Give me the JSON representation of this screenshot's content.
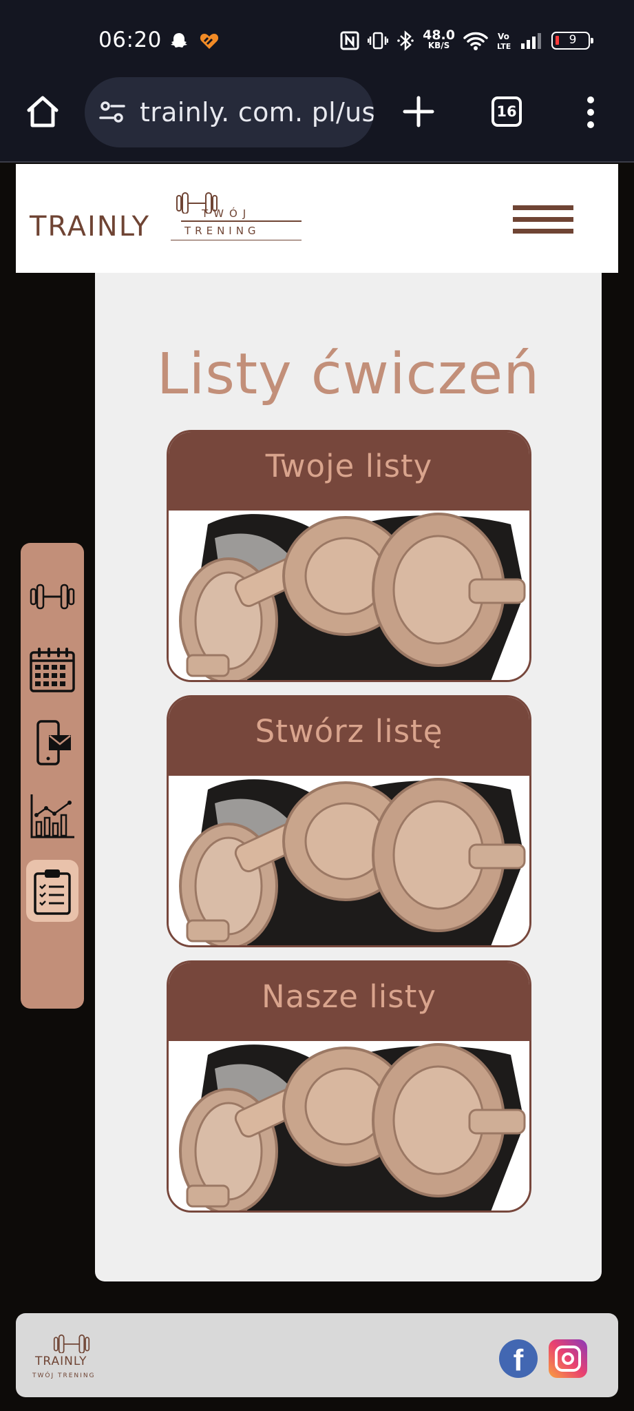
{
  "status_bar": {
    "time": "06:20",
    "net_speed_value": "48.0",
    "net_speed_unit": "KB/S",
    "battery": "9",
    "icons": [
      "snapchat-icon",
      "notification-heart-icon",
      "nfc-icon",
      "vibrate-icon",
      "bluetooth-icon",
      "wifi-icon",
      "volte-icon",
      "signal-icon",
      "battery-icon"
    ]
  },
  "browser": {
    "url": "trainly. com. pl/us",
    "tab_count": "16",
    "icons": [
      "home-icon",
      "site-settings-icon",
      "plus-icon",
      "tabs-icon",
      "more-vert-icon"
    ]
  },
  "header": {
    "logo_main": "TRAINLY",
    "logo_sub_1": "TWÓJ",
    "logo_sub_2": "TRENING",
    "menu_icon": "hamburger-icon"
  },
  "page": {
    "title": "Listy ćwiczeń",
    "cards": [
      {
        "label": "Twoje listy"
      },
      {
        "label": "Stwórz listę"
      },
      {
        "label": "Nasze listy"
      }
    ]
  },
  "side_nav": {
    "items": [
      {
        "icon": "dumbbell-icon",
        "active": false
      },
      {
        "icon": "calendar-icon",
        "active": false
      },
      {
        "icon": "phone-mail-icon",
        "active": false
      },
      {
        "icon": "chart-icon",
        "active": false
      },
      {
        "icon": "clipboard-checklist-icon",
        "active": true
      }
    ]
  },
  "footer": {
    "logo_main": "TRAINLY",
    "logo_sub": "TWÓJ TRENING",
    "social": [
      "facebook-icon",
      "instagram-icon"
    ],
    "facebook_glyph": "f"
  },
  "colors": {
    "brand_brown": "#77473c",
    "accent_tan": "#c28f79",
    "card_text": "#d9a48d",
    "panel_bg": "#efefef"
  }
}
